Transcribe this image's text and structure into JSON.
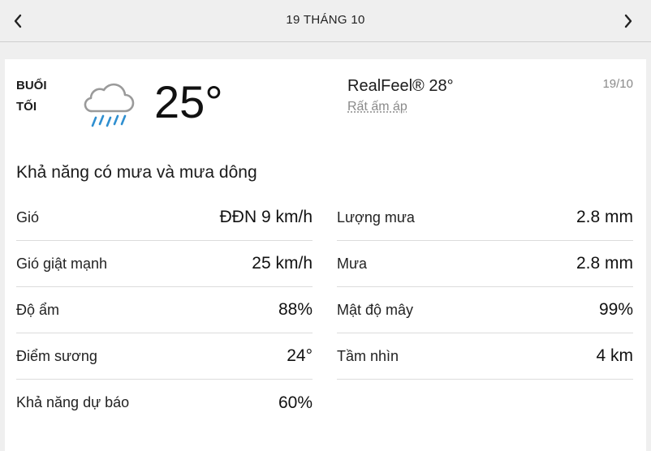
{
  "header": {
    "title": "19 THÁNG 10",
    "prev_icon": "chevron-left-icon",
    "next_icon": "chevron-right-icon"
  },
  "current": {
    "period_line1": "BUỔI",
    "period_line2": "TỐI",
    "icon": "cloud-rain-icon",
    "temperature": "25°",
    "realfeel": "RealFeel® 28°",
    "realfeel_desc": "Rất ấm áp",
    "date": "19/10",
    "phrase": "Khả năng có mưa và mưa dông"
  },
  "details_left": [
    {
      "label": "Gió",
      "value": "ĐĐN 9 km/h"
    },
    {
      "label": "Gió giật mạnh",
      "value": "25 km/h"
    },
    {
      "label": "Độ ẩm",
      "value": "88%"
    },
    {
      "label": "Điểm sương",
      "value": "24°"
    },
    {
      "label": "Khả năng dự báo",
      "value": "60%"
    }
  ],
  "details_right": [
    {
      "label": "Lượng mưa",
      "value": "2.8 mm"
    },
    {
      "label": "Mưa",
      "value": "2.8 mm"
    },
    {
      "label": "Mật độ mây",
      "value": "99%"
    },
    {
      "label": "Tầm nhìn",
      "value": "4 km"
    }
  ],
  "colors": {
    "background": "#efefef",
    "card": "#ffffff",
    "muted_text": "#8a8a8a",
    "rain_icon": "#2f8fd0",
    "cloud_icon": "#9a9a9a"
  }
}
